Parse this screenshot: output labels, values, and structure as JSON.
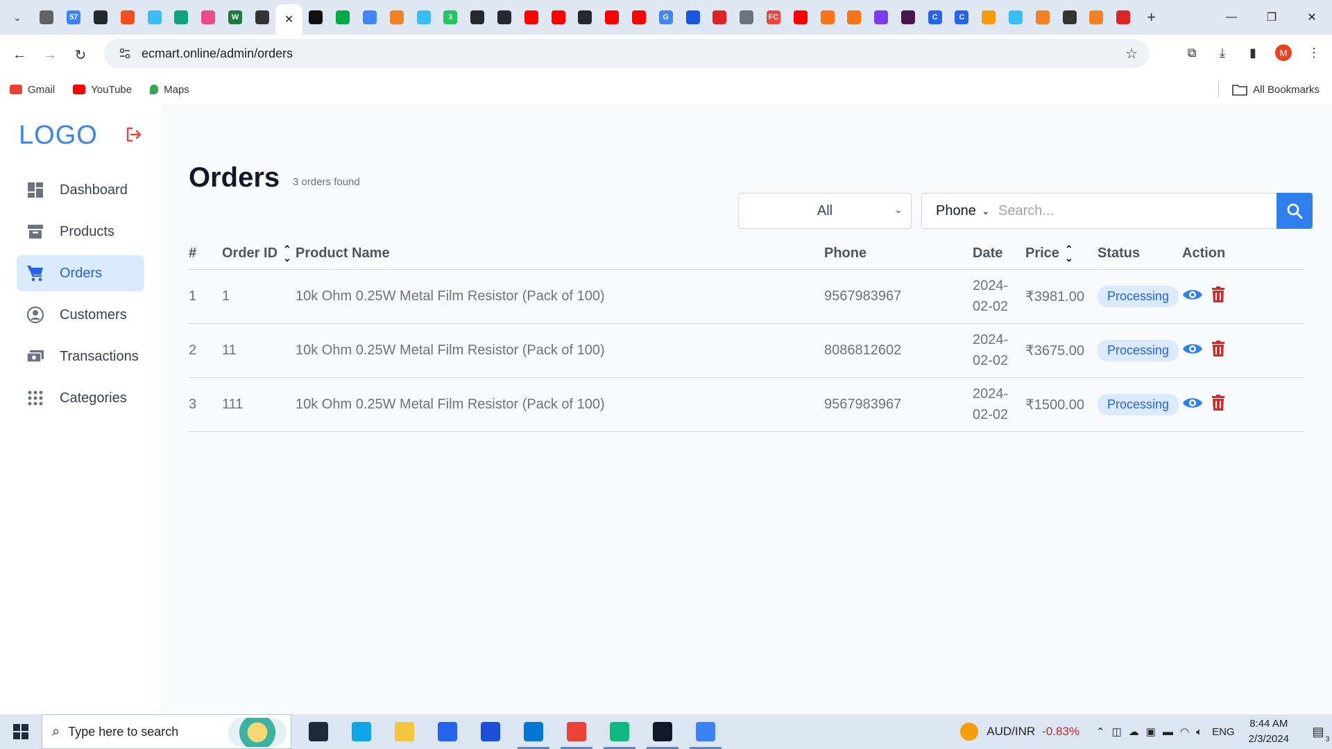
{
  "browser": {
    "url": "ecmart.online/admin/orders",
    "tab_badge_count": "57",
    "profile_initial": "M",
    "tab_favicons": [
      {
        "name": "chrome-icon",
        "color": "#5f6368",
        "glyph": ""
      },
      {
        "name": "badge-57-icon",
        "color": "#3b82f6",
        "glyph": "57"
      },
      {
        "name": "github-icon",
        "color": "#24292f",
        "glyph": ""
      },
      {
        "name": "figma-icon",
        "color": "#f24e1e",
        "glyph": ""
      },
      {
        "name": "tailwind-icon",
        "color": "#38bdf8",
        "glyph": ""
      },
      {
        "name": "chatgpt-icon",
        "color": "#10a37f",
        "glyph": ""
      },
      {
        "name": "dribbble-icon",
        "color": "#ea4c89",
        "glyph": ""
      },
      {
        "name": "webflow-icon",
        "color": "#1b7a3e",
        "glyph": "W"
      },
      {
        "name": "dark-app-icon",
        "color": "#333333",
        "glyph": ""
      },
      {
        "name": "close-tab-icon",
        "color": "#ffffff",
        "glyph": "✕",
        "active": true
      },
      {
        "name": "codepen-icon",
        "color": "#111111",
        "glyph": ""
      },
      {
        "name": "meet-icon",
        "color": "#00ac47",
        "glyph": ""
      },
      {
        "name": "puzzle-icon",
        "color": "#4285f4",
        "glyph": ""
      },
      {
        "name": "stack-icon",
        "color": "#f48024",
        "glyph": ""
      },
      {
        "name": "tailwind-icon",
        "color": "#38bdf8",
        "glyph": ""
      },
      {
        "name": "green-3-icon",
        "color": "#22c55e",
        "glyph": "3"
      },
      {
        "name": "github-icon",
        "color": "#24292f",
        "glyph": ""
      },
      {
        "name": "github-icon",
        "color": "#24292f",
        "glyph": ""
      },
      {
        "name": "youtube-icon",
        "color": "#ff0000",
        "glyph": ""
      },
      {
        "name": "youtube-icon",
        "color": "#ff0000",
        "glyph": ""
      },
      {
        "name": "github-icon",
        "color": "#24292f",
        "glyph": ""
      },
      {
        "name": "youtube-icon",
        "color": "#ff0000",
        "glyph": ""
      },
      {
        "name": "youtube-icon",
        "color": "#ff0000",
        "glyph": ""
      },
      {
        "name": "google-icon",
        "color": "#4285f4",
        "glyph": "G"
      },
      {
        "name": "blue-play-icon",
        "color": "#1a56db",
        "glyph": ""
      },
      {
        "name": "red-box-icon",
        "color": "#e02424",
        "glyph": ""
      },
      {
        "name": "globe-icon",
        "color": "#6b7280",
        "glyph": ""
      },
      {
        "name": "fc-icon",
        "color": "#ef4444",
        "glyph": "FC"
      },
      {
        "name": "youtube-icon",
        "color": "#ff0000",
        "glyph": ""
      },
      {
        "name": "orange-icon",
        "color": "#f97316",
        "glyph": ""
      },
      {
        "name": "orange-icon",
        "color": "#f97316",
        "glyph": ""
      },
      {
        "name": "purple-icon",
        "color": "#7c3aed",
        "glyph": ""
      },
      {
        "name": "slack-like-icon",
        "color": "#4a154b",
        "glyph": ""
      },
      {
        "name": "c-blue-icon",
        "color": "#2563eb",
        "glyph": "C"
      },
      {
        "name": "c-blue-icon",
        "color": "#2563eb",
        "glyph": "C"
      },
      {
        "name": "files-icon",
        "color": "#f59e0b",
        "glyph": ""
      },
      {
        "name": "tailwind-icon",
        "color": "#38bdf8",
        "glyph": ""
      },
      {
        "name": "stack-icon",
        "color": "#f48024",
        "glyph": ""
      },
      {
        "name": "dark-app-icon",
        "color": "#333333",
        "glyph": ""
      },
      {
        "name": "stack-icon",
        "color": "#f48024",
        "glyph": ""
      },
      {
        "name": "red-flag-icon",
        "color": "#dc2626",
        "glyph": ""
      }
    ]
  },
  "bookmarks": {
    "items": [
      {
        "label": "Gmail",
        "color": "#ea4335"
      },
      {
        "label": "YouTube",
        "color": "#ff0000"
      },
      {
        "label": "Maps",
        "color": "#34a853"
      }
    ],
    "all_bookmarks": "All Bookmarks"
  },
  "sidebar": {
    "logo": "LOGO",
    "items": [
      {
        "label": "Dashboard",
        "icon": "dashboard-icon",
        "active": false
      },
      {
        "label": "Products",
        "icon": "archive-icon",
        "active": false
      },
      {
        "label": "Orders",
        "icon": "cart-icon",
        "active": true
      },
      {
        "label": "Customers",
        "icon": "user-circle-icon",
        "active": false
      },
      {
        "label": "Transactions",
        "icon": "money-icon",
        "active": false
      },
      {
        "label": "Categories",
        "icon": "grid-dots-icon",
        "active": false
      }
    ]
  },
  "main": {
    "title": "Orders",
    "count_text": "3 orders found",
    "filter": {
      "selected": "All"
    },
    "search": {
      "field": "Phone",
      "placeholder": "Search...",
      "value": ""
    },
    "columns": {
      "index": "#",
      "order_id": "Order ID",
      "product": "Product Name",
      "phone": "Phone",
      "date": "Date",
      "price": "Price",
      "status": "Status",
      "action": "Action"
    },
    "rows": [
      {
        "index": "1",
        "order_id": "1",
        "product": "10k Ohm 0.25W Metal Film Resistor (Pack of 100)",
        "phone": "9567983967",
        "date": "2024-02-02",
        "price": "₹3981.00",
        "status": "Processing"
      },
      {
        "index": "2",
        "order_id": "11",
        "product": "10k Ohm 0.25W Metal Film Resistor (Pack of 100)",
        "phone": "8086812602",
        "date": "2024-02-02",
        "price": "₹3675.00",
        "status": "Processing"
      },
      {
        "index": "3",
        "order_id": "111",
        "product": "10k Ohm 0.25W Metal Film Resistor (Pack of 100)",
        "phone": "9567983967",
        "date": "2024-02-02",
        "price": "₹1500.00",
        "status": "Processing"
      }
    ]
  },
  "taskbar": {
    "search_placeholder": "Type here to search",
    "ticker_pair": "AUD/INR",
    "ticker_change": "-0.83%",
    "language": "ENG",
    "time": "8:44 AM",
    "date": "2/3/2024",
    "notification_count": "3",
    "apps": [
      {
        "name": "task-view-icon",
        "color": "#1f2937",
        "running": false
      },
      {
        "name": "edge-icon",
        "color": "#0ea5e9",
        "running": false
      },
      {
        "name": "file-explorer-icon",
        "color": "#f5c542",
        "running": false
      },
      {
        "name": "store-icon",
        "color": "#2563eb",
        "running": false
      },
      {
        "name": "mail-icon",
        "color": "#1d4ed8",
        "running": false
      },
      {
        "name": "vscode-icon",
        "color": "#0078d4",
        "running": true
      },
      {
        "name": "chrome-icon",
        "color": "#ea4335",
        "running": true
      },
      {
        "name": "mongodb-icon",
        "color": "#10b981",
        "running": true
      },
      {
        "name": "terminal-icon",
        "color": "#111827",
        "running": true
      },
      {
        "name": "photos-icon",
        "color": "#3b82f6",
        "running": true
      }
    ]
  },
  "colors": {
    "accent": "#2f80ed",
    "active_nav_bg": "#dbeafe",
    "badge_bg": "#dbeafe",
    "badge_text": "#2563eb",
    "delete": "#dc2626",
    "logout": "#ef4444"
  }
}
